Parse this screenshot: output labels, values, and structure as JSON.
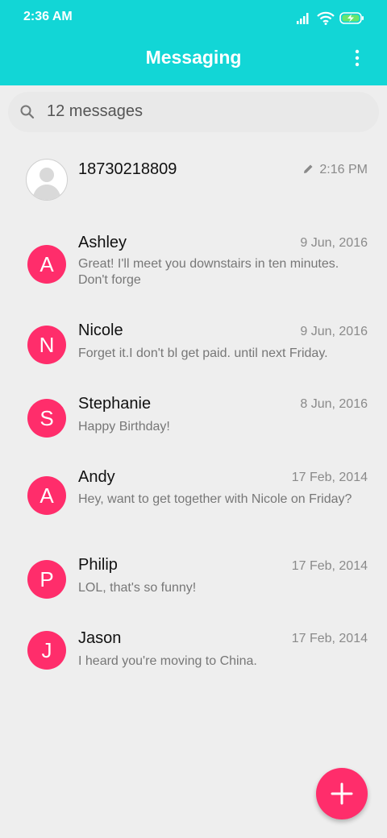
{
  "status_bar": {
    "time": "2:36 AM",
    "icons": [
      "signal-icon",
      "wifi-icon",
      "battery-charging-icon"
    ]
  },
  "header": {
    "title": "Messaging",
    "menu_icon": "more-vert-icon"
  },
  "search": {
    "text": "12 messages",
    "icon": "search-icon"
  },
  "conversations": [
    {
      "name": "18730218809",
      "initial": "",
      "time": "2:16 PM",
      "draft": true,
      "snippet": ""
    },
    {
      "name": "Ashley",
      "initial": "A",
      "time": "9 Jun, 2016",
      "draft": false,
      "snippet": "Great! I'll meet you downstairs in ten minutes. Don't forge"
    },
    {
      "name": "Nicole",
      "initial": "N",
      "time": "9 Jun, 2016",
      "draft": false,
      "snippet": "Forget it.I don't bl get paid. until next Friday."
    },
    {
      "name": "Stephanie",
      "initial": "S",
      "time": "8 Jun, 2016",
      "draft": false,
      "snippet": "Happy Birthday!"
    },
    {
      "name": "Andy",
      "initial": "A",
      "time": "17 Feb, 2014",
      "draft": false,
      "snippet": "Hey, want to get together with Nicole on Friday?"
    },
    {
      "name": "Philip",
      "initial": "P",
      "time": "17 Feb, 2014",
      "draft": false,
      "snippet": "LOL, that's so funny!"
    },
    {
      "name": "Jason",
      "initial": "J",
      "time": "17 Feb, 2014",
      "draft": false,
      "snippet": "I heard you're moving to China."
    }
  ],
  "fab": {
    "icon": "plus-icon"
  },
  "colors": {
    "header": "#12d6d6",
    "avatar": "#ff2d6b",
    "background": "#eeeeee"
  }
}
